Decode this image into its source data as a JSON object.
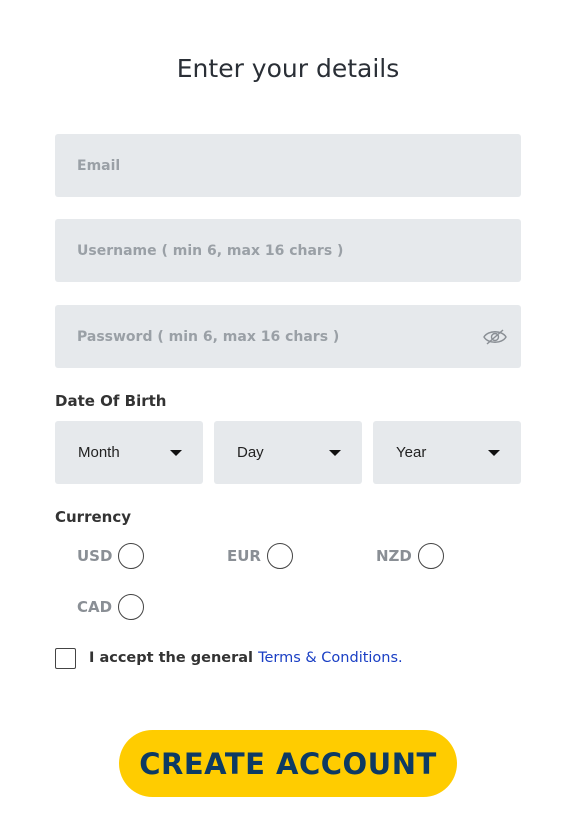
{
  "title": "Enter your details",
  "fields": {
    "email": {
      "placeholder": "Email",
      "value": ""
    },
    "username": {
      "placeholder": "Username ( min 6, max 16 chars )",
      "value": ""
    },
    "password": {
      "placeholder": "Password ( min 6, max 16 chars )",
      "value": "",
      "toggle_icon": "eye-slash-icon"
    }
  },
  "dob": {
    "label": "Date Of Birth",
    "month": "Month",
    "day": "Day",
    "year": "Year"
  },
  "currency": {
    "label": "Currency",
    "options": [
      "USD",
      "EUR",
      "NZD",
      "CAD"
    ],
    "selected": null
  },
  "terms": {
    "prefix": "I accept the general ",
    "link": "Terms & Conditions.",
    "checked": false,
    "link_color": "#1a3fc4"
  },
  "cta": {
    "label": "CREATE ACCOUNT",
    "background": "#ffcc00",
    "text_color": "#0d3a63"
  }
}
